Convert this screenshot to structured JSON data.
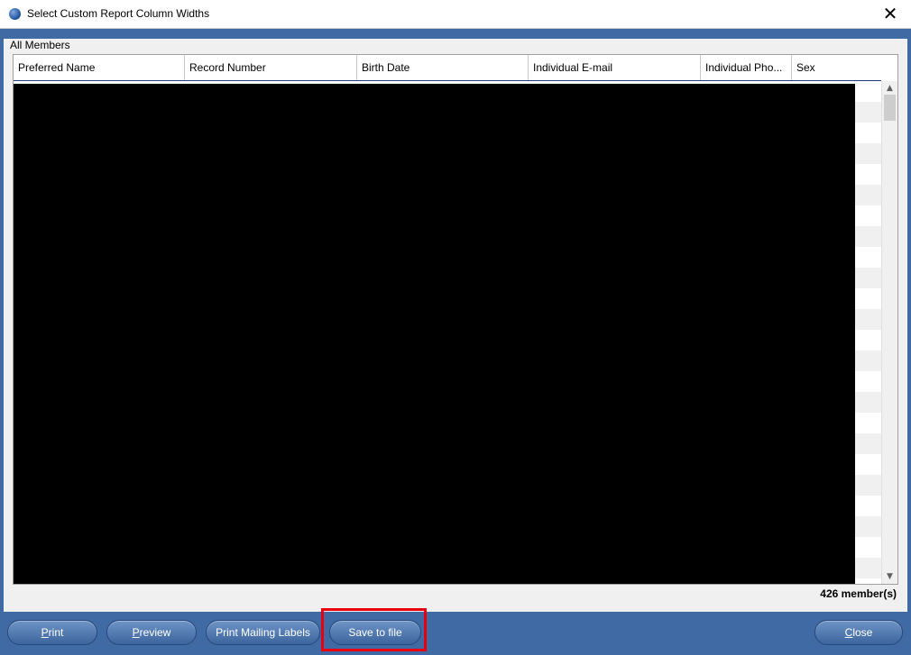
{
  "window": {
    "title": "Select Custom Report Column Widths",
    "close_glyph": "✕"
  },
  "group": {
    "label": "All Members"
  },
  "table": {
    "columns": [
      "Preferred Name",
      "Record Number",
      "Birth Date",
      "Individual E-mail",
      "Individual Pho...",
      "Sex"
    ]
  },
  "scrollbar": {
    "up_glyph": "▲",
    "down_glyph": "▼"
  },
  "status": {
    "member_count": "426 member(s)"
  },
  "footer": {
    "print": {
      "first": "P",
      "rest": "rint"
    },
    "preview": {
      "first": "P",
      "rest": "review"
    },
    "print_mailing_labels": "Print Mailing Labels",
    "save_to_file": "Save to file",
    "close": {
      "first": "C",
      "rest": "lose"
    }
  },
  "colors": {
    "frame_blue": "#3f6aa3",
    "highlight_red": "#e8000d",
    "redaction": "#000000"
  }
}
